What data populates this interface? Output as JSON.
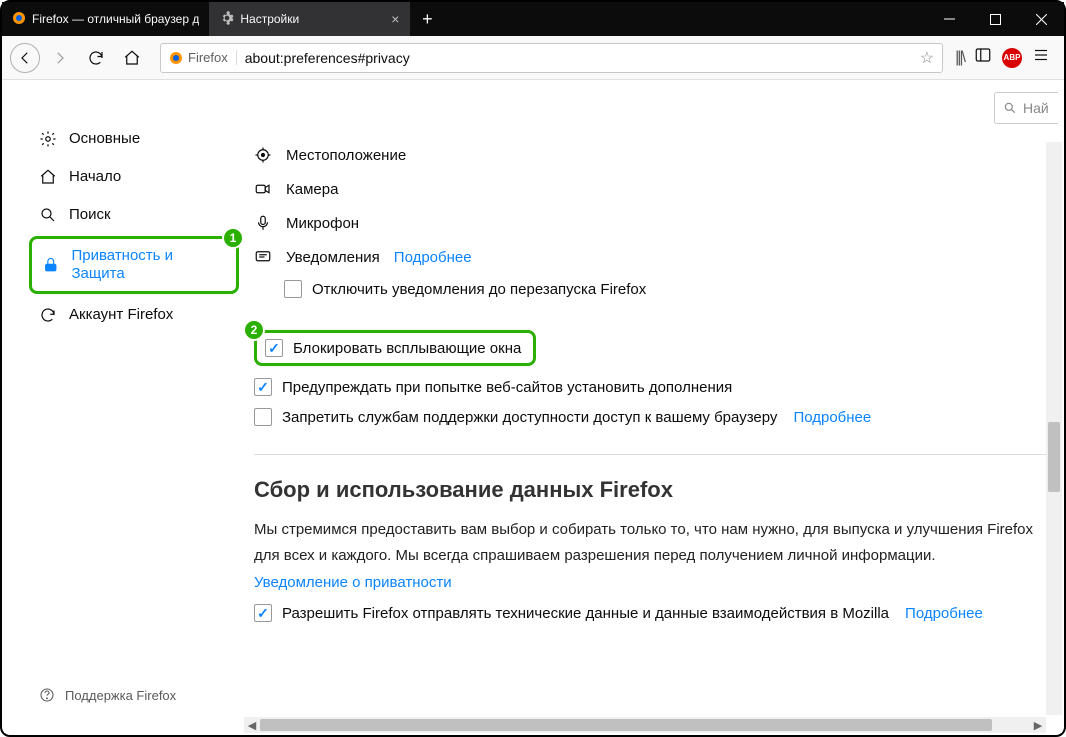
{
  "tabs": [
    {
      "title": "Firefox — отличный браузер д",
      "active": false
    },
    {
      "title": "Настройки",
      "active": true
    }
  ],
  "url": {
    "prefix": "Firefox",
    "address": "about:preferences#privacy"
  },
  "search": {
    "placeholder": "Най"
  },
  "sidebar": {
    "items": [
      {
        "label": "Основные"
      },
      {
        "label": "Начало"
      },
      {
        "label": "Поиск"
      },
      {
        "label": "Приватность и Защита"
      },
      {
        "label": "Аккаунт Firefox"
      }
    ],
    "support": "Поддержка Firefox"
  },
  "annotations": {
    "badge1": "1",
    "badge2": "2"
  },
  "permissions": {
    "location": "Местоположение",
    "camera": "Камера",
    "microphone": "Микрофон",
    "notifications": "Уведомления",
    "more": "Подробнее",
    "disable_notifications": "Отключить уведомления до перезапуска Firefox"
  },
  "options": {
    "block_popups": "Блокировать всплывающие окна",
    "warn_addons": "Предупреждать при попытке веб-сайтов установить дополнения",
    "block_a11y": "Запретить службам поддержки доступности доступ к вашему браузеру",
    "more": "Подробнее"
  },
  "data_section": {
    "title": "Сбор и использование данных Firefox",
    "text": "Мы стремимся предоставить вам выбор и собирать только то, что нам нужно, для выпуска и улучшения Firefox для всех и каждого. Мы всегда спрашиваем разрешения перед получением личной информации.",
    "privacy_link": "Уведомление о приватности",
    "telemetry": "Разрешить Firefox отправлять технические данные и данные взаимодействия в Mozilla",
    "more": "Подробнее"
  }
}
